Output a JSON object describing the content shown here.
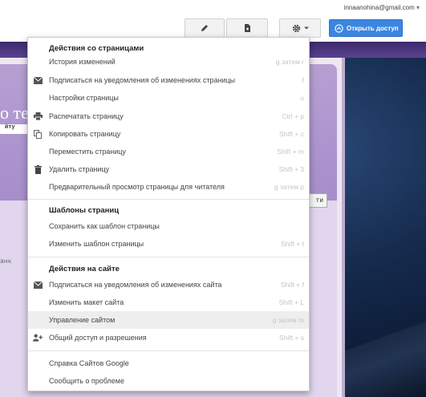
{
  "header": {
    "email": "innaanohina@gmail.com",
    "share_label": "Открыть доступ"
  },
  "background_page": {
    "title_fragment": "о те",
    "subtitle_fragment": "йту",
    "button_fragment": "ти",
    "body_fragment": "анк"
  },
  "menu": {
    "sections": [
      {
        "title": "Действия со страницами",
        "items": [
          {
            "label": "История изменений",
            "shortcut": "g затем r",
            "icon": ""
          },
          {
            "label": "Подписаться на уведомления об изменениях страницы",
            "shortcut": "f",
            "icon": "envelope-icon"
          },
          {
            "label": "Настройки страницы",
            "shortcut": "u",
            "icon": ""
          },
          {
            "label": "Распечатать страницу",
            "shortcut": "Ctrl + p",
            "icon": "printer-icon"
          },
          {
            "label": "Копировать страницу",
            "shortcut": "Shift + c",
            "icon": "copy-icon"
          },
          {
            "label": "Переместить страницу",
            "shortcut": "Shift + m",
            "icon": ""
          },
          {
            "label": "Удалить страницу",
            "shortcut": "Shift + 3",
            "icon": "trash-icon"
          },
          {
            "label": "Предварительный просмотр страницы для читателя",
            "shortcut": "g затем p",
            "icon": ""
          }
        ]
      },
      {
        "title": "Шаблоны страниц",
        "items": [
          {
            "label": "Сохранить как шаблон страницы",
            "shortcut": "",
            "icon": ""
          },
          {
            "label": "Изменить шаблон страницы",
            "shortcut": "Shift + t",
            "icon": ""
          }
        ]
      },
      {
        "title": "Действия на сайте",
        "items": [
          {
            "label": "Подписаться на уведомления об изменениях сайта",
            "shortcut": "Shift + f",
            "icon": "envelope-icon"
          },
          {
            "label": "Изменить макет сайта",
            "shortcut": "Shift + L",
            "icon": ""
          },
          {
            "label": "Управление сайтом",
            "shortcut": "g затем m",
            "icon": "",
            "highlighted": true
          },
          {
            "label": "Общий доступ и разрешения",
            "shortcut": "Shift + s",
            "icon": "add-person-icon"
          }
        ]
      },
      {
        "title": "",
        "items": [
          {
            "label": "Справка Сайтов Google",
            "shortcut": "",
            "icon": ""
          },
          {
            "label": "Сообщить о проблеме",
            "shortcut": "",
            "icon": ""
          }
        ]
      }
    ]
  },
  "colors": {
    "share_button": "#3b86e0",
    "menu_highlight": "#eeeeee",
    "site_background": "#0a1730"
  }
}
